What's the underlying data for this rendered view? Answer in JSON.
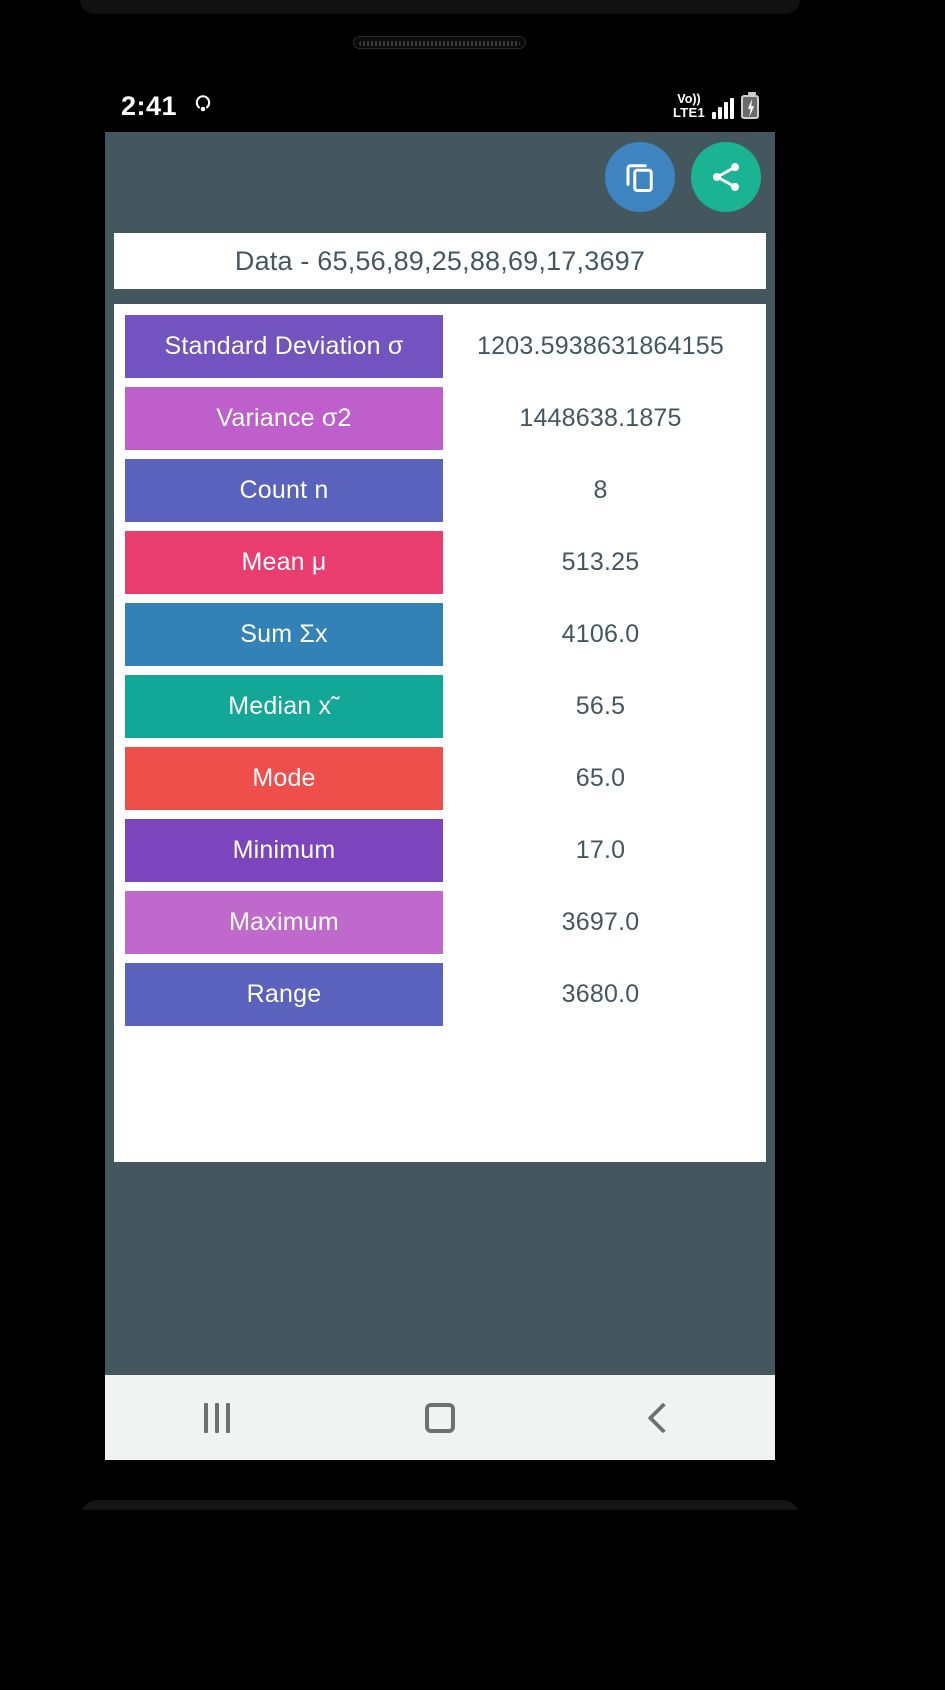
{
  "statusbar": {
    "time": "2:41",
    "cast_icon": "cast-icon",
    "network_top": "Vo))",
    "network_bottom": "LTE1",
    "signal_icon": "signal-bars-icon",
    "battery_icon": "battery-charging-icon"
  },
  "appbar": {
    "copy_icon": "copy-icon",
    "share_icon": "share-icon",
    "copy_label": "Copy",
    "share_label": "Share"
  },
  "data_header": {
    "text": "Data - 65,56,89,25,88,69,17,3697",
    "values": [
      65,
      56,
      89,
      25,
      88,
      69,
      17,
      3697
    ]
  },
  "results": {
    "rows": [
      {
        "label": "Standard Deviation σ",
        "value": "1203.5938631864155",
        "color": "#7253c0"
      },
      {
        "label": "Variance σ2",
        "value": "1448638.1875",
        "color": "#bf5fcb"
      },
      {
        "label": "Count n",
        "value": "8",
        "color": "#5a62be"
      },
      {
        "label": "Mean μ",
        "value": "513.25",
        "color": "#ea3d6f"
      },
      {
        "label": "Sum Σx",
        "value": "4106.0",
        "color": "#3282b8"
      },
      {
        "label": "Median x˜",
        "value": "56.5",
        "color": "#13a797"
      },
      {
        "label": "Mode",
        "value": "65.0",
        "color": "#ef4f4b"
      },
      {
        "label": "Minimum",
        "value": "17.0",
        "color": "#7c44bd"
      },
      {
        "label": "Maximum",
        "value": "3697.0",
        "color": "#c069cd"
      },
      {
        "label": "Range",
        "value": "3680.0",
        "color": "#5a62be"
      }
    ]
  },
  "navbar": {
    "recents_label": "Recents",
    "home_label": "Home",
    "back_label": "Back"
  },
  "theme": {
    "app_background": "#44575e",
    "card_background": "#ffffff",
    "value_text": "#46565e",
    "copy_button": "#3d84c0",
    "share_button": "#1ab394"
  }
}
